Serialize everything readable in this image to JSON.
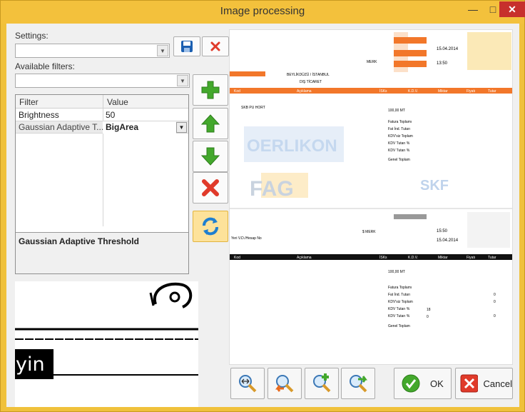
{
  "window": {
    "title": "Image processing",
    "minimize": "—",
    "maximize": "□",
    "close": "✕"
  },
  "settings": {
    "label": "Settings:",
    "value": ""
  },
  "filters": {
    "label": "Available filters:",
    "value": ""
  },
  "grid": {
    "headers": [
      "Filter",
      "Value"
    ],
    "rows": [
      {
        "filter": "Brightness",
        "value": "50"
      },
      {
        "filter": "Gaussian Adaptive T...",
        "value": "BigArea"
      }
    ],
    "description": "Gaussian Adaptive Threshold"
  },
  "preview": {
    "text": "yin"
  },
  "document": {
    "header_dates": [
      "15.04.2014",
      "13:50"
    ],
    "address": "BEYLİKDÜZÜ / İSTANBUL",
    "region": "DIŞ TİCARET",
    "merk": "MERK",
    "columns": [
      "Kod",
      "Açıklama",
      "İSKs",
      "K.D.V.",
      "Miktar",
      "Fiyatı",
      "Tutar"
    ],
    "item_code": "SKB PU HORT",
    "qty": "100,00 MT",
    "totals": [
      "Fatura Toplamı",
      "Fat İnd. Tutarı",
      "KDV'siz Toplam",
      "KDV Tutarı %",
      "KDV Tutarı %",
      "Genel Toplam"
    ],
    "kdv_rates": [
      "18",
      "0"
    ],
    "zero_values": [
      "0",
      "0",
      "0"
    ],
    "watermarks": [
      "OERLIKON",
      "FAG",
      "SKF"
    ],
    "second_header_dates": [
      "15.04.2014",
      "15:50"
    ],
    "seller_tag": "Yeri V.D./Hesap No",
    "mark": "$ MERK"
  },
  "buttons": {
    "ok": "OK",
    "cancel": "Cancel"
  },
  "colors": {
    "titlebar": "#f3c13c",
    "close": "#c7302c",
    "accent_green": "#43a82c",
    "accent_red": "#e03a2a"
  }
}
